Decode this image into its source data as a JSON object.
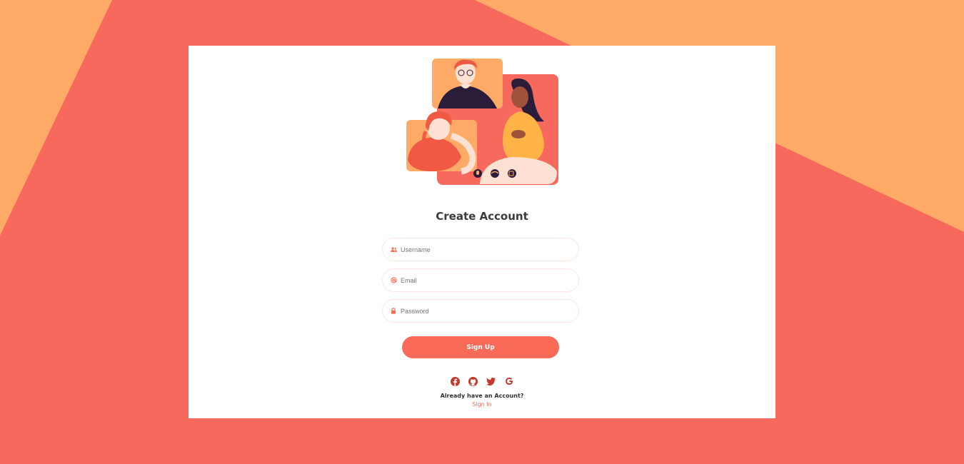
{
  "colors": {
    "background_coral": "#f7695c",
    "background_peach": "#ffab67",
    "accent": "#f96a59",
    "card": "#ffffff",
    "social_icons": "#c0392b"
  },
  "form": {
    "title": "Create Account",
    "username": {
      "placeholder": "Username",
      "value": "",
      "icon": "users-icon"
    },
    "email": {
      "placeholder": "Email",
      "value": "",
      "icon": "at-icon"
    },
    "password": {
      "placeholder": "Password",
      "value": "",
      "icon": "lock-icon"
    },
    "submit_label": "Sign Up"
  },
  "social": {
    "icons": [
      "facebook-icon",
      "github-icon",
      "twitter-icon",
      "google-icon"
    ]
  },
  "footer": {
    "prompt": "Already have an Account?",
    "link": "Sign In"
  }
}
